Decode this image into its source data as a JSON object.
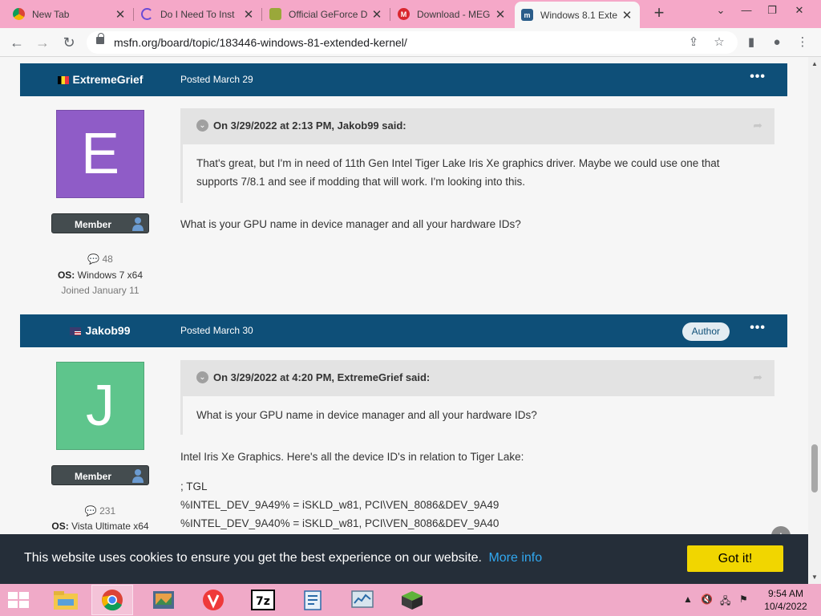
{
  "browser": {
    "tabs": [
      {
        "title": "New Tab",
        "icon": "chrome-icon",
        "active": false
      },
      {
        "title": "Do I Need To Inst",
        "icon": "crescent-icon",
        "active": false
      },
      {
        "title": "Official GeForce D",
        "icon": "nvidia-icon",
        "active": false
      },
      {
        "title": "Download - MEG",
        "icon": "mega-icon",
        "active": false
      },
      {
        "title": "Windows 8.1 Exte",
        "icon": "msfn-icon",
        "active": true
      }
    ],
    "url": "msfn.org/board/topic/183446-windows-81-extended-kernel/"
  },
  "posts": [
    {
      "author": "ExtremeGrief",
      "flag": "belgium-flag",
      "posted": "Posted March 29",
      "author_badge": "",
      "avatar_letter": "E",
      "avatar_color": "#8f5cc7",
      "rank": "Member",
      "post_count": "48",
      "os_label": "OS:",
      "os_value": "Windows 7 x64",
      "joined": "Joined January 11",
      "quote_title": "On 3/29/2022 at 2:13 PM, Jakob99 said:",
      "quote_lines": [
        "That's great, but I'm in need of 11th Gen Intel Tiger Lake Iris Xe graphics driver. Maybe we could use one that",
        "supports 7/8.1 and see if modding that will work. I'm looking into this."
      ],
      "content_lines": [
        "What is your GPU name in device manager and all your hardware IDs?"
      ]
    },
    {
      "author": "Jakob99",
      "flag": "us-flag",
      "posted": "Posted March 30",
      "author_badge": "Author",
      "avatar_letter": "J",
      "avatar_color": "#5ec58c",
      "rank": "Member",
      "post_count": "231",
      "os_label": "OS:",
      "os_value": "Vista Ultimate x64",
      "quote_title": "On 3/29/2022 at 4:20 PM, ExtremeGrief said:",
      "quote_lines": [
        "What is your GPU name in device manager and all your hardware IDs?"
      ],
      "content_lines": [
        "Intel Iris Xe Graphics. Here's all the device ID's in relation to Tiger Lake:",
        "; TGL",
        "%INTEL_DEV_9A49% = iSKLD_w81, PCI\\VEN_8086&DEV_9A49",
        "%INTEL_DEV_9A40% = iSKLD_w81, PCI\\VEN_8086&DEV_9A40"
      ]
    }
  ],
  "cookie_bar": {
    "message": "This website uses cookies to ensure you get the best experience on our website.",
    "more_info": "More info",
    "button": "Got it!"
  },
  "taskbar": {
    "apps": [
      "file-explorer-icon",
      "chrome-icon",
      "photo-app-icon",
      "vivaldi-icon",
      "7zip-icon",
      "notepad-icon",
      "task-manager-icon",
      "minecraft-icon"
    ],
    "time": "9:54 AM",
    "date": "10/4/2022"
  }
}
